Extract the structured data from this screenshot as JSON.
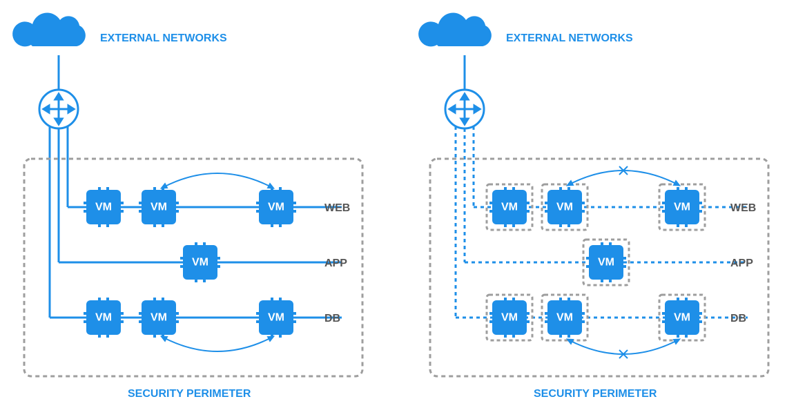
{
  "diagram": {
    "left": {
      "external_label": "EXTERNAL NETWORKS",
      "perimeter_label": "SECURITY PERIMETER",
      "vm_label": "VM",
      "tiers": {
        "web": "WEB",
        "app": "APP",
        "db": "DB"
      },
      "connection_style": "solid",
      "micro_segmented": false
    },
    "right": {
      "external_label": "EXTERNAL NETWORKS",
      "perimeter_label": "SECURITY PERIMETER",
      "vm_label": "VM",
      "tiers": {
        "web": "WEB",
        "app": "APP",
        "db": "DB"
      },
      "connection_style": "dashed",
      "micro_segmented": true,
      "blocked_lateral": true
    },
    "colors": {
      "primary": "#1E8FE8",
      "perimeter": "#9E9E9E",
      "tier_text": "#555555"
    }
  }
}
